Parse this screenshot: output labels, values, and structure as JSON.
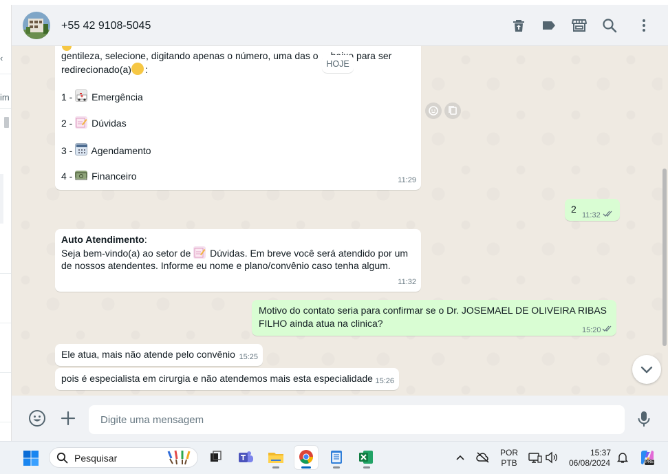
{
  "sidebar_fragments": {
    "chev": "‹",
    "cut_text": "im"
  },
  "header": {
    "contact_name": "+55 42 9108-5045"
  },
  "chat": {
    "date_chip": "HOJE",
    "messages": [
      {
        "dir": "in",
        "partial_line1": "gentileza, selecione, digitando apenas o número, uma das o",
        "partial_line1_end": "baixo para ser",
        "line2": "redirecionado(a)",
        "line2_emoji_suffix": ":",
        "menu": [
          {
            "prefix": "1 -",
            "label": "Emergência"
          },
          {
            "prefix": "2 -",
            "label": "Dúvidas"
          },
          {
            "prefix": "3 -",
            "label": "Agendamento"
          },
          {
            "prefix": "4 -",
            "label": "Financeiro"
          }
        ],
        "time": "11:29"
      },
      {
        "dir": "out",
        "text": "2",
        "time": "11:32",
        "status": "read"
      },
      {
        "dir": "in",
        "title": "Auto Atendimento",
        "title_suffix": ":",
        "text_pre": "Seja bem-vindo(a) ao setor de",
        "text_post": "Dúvidas. Em breve você será atendido por um",
        "line2": "de nossos atendentes. Informe eu nome e plano/convênio caso tenha algum.",
        "time": "11:32"
      },
      {
        "dir": "out",
        "line1": "Motivo do contato seria para confirmar se o Dr. JOSEMAEL DE OLIVEIRA RIBAS",
        "line2": "FILHO ainda atua na clinica?",
        "time": "15:20",
        "status": "read"
      },
      {
        "dir": "in",
        "text": "Ele atua, mais não atende pelo convênio",
        "time": "15:25"
      },
      {
        "dir": "in",
        "text": "pois é especialista em cirurgia e não atendemos mais esta especialidade",
        "time": "15:26"
      }
    ]
  },
  "composer": {
    "placeholder": "Digite uma mensagem"
  },
  "taskbar": {
    "search_label": "Pesquisar",
    "lang_line1": "POR",
    "lang_line2": "PTB",
    "time": "15:37",
    "date": "06/08/2024",
    "copilot_badge": "PRE"
  },
  "colors": {
    "outgoing_bubble": "#d9fdd3",
    "incoming_bubble": "#ffffff",
    "chat_bg": "#efeae2",
    "read_ticks": "#667781",
    "header_bg": "#f0f2f5"
  },
  "icons": [
    "delete-icon",
    "label-icon",
    "store-icon",
    "search-icon",
    "menu-dots-icon",
    "emoji-icon",
    "attach-plus-icon",
    "microphone-icon",
    "chevron-down-icon"
  ]
}
